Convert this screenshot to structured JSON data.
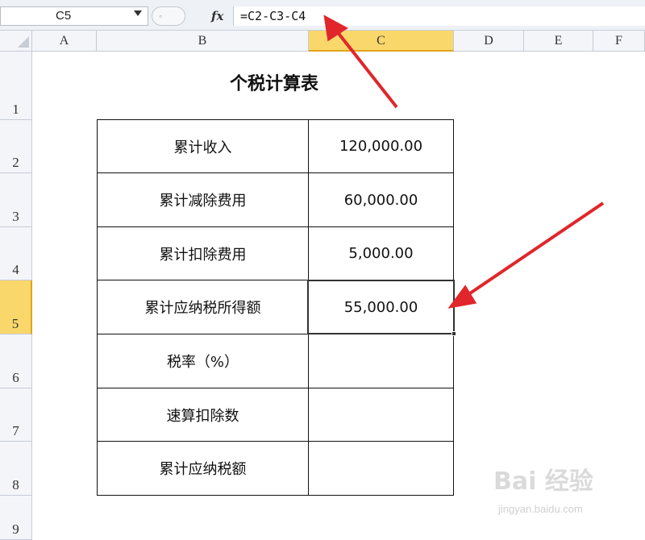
{
  "formula_bar": {
    "name_box": "C5",
    "fx_label": "fx",
    "formula": "=C2-C3-C4"
  },
  "columns": [
    {
      "label": "A",
      "active": false
    },
    {
      "label": "B",
      "active": false
    },
    {
      "label": "C",
      "active": true
    },
    {
      "label": "D",
      "active": false
    },
    {
      "label": "E",
      "active": false
    },
    {
      "label": "F",
      "active": false
    }
  ],
  "rows": [
    "1",
    "2",
    "3",
    "4",
    "5",
    "6",
    "7",
    "8",
    "9"
  ],
  "active_row": "5",
  "sheet": {
    "title": "个税计算表",
    "table": [
      {
        "label": "累计收入",
        "value": "120,000.00"
      },
      {
        "label": "累计减除费用",
        "value": "60,000.00"
      },
      {
        "label": "累计扣除费用",
        "value": "5,000.00"
      },
      {
        "label": "累计应纳税所得额",
        "value": "55,000.00"
      },
      {
        "label": "税率（%）",
        "value": ""
      },
      {
        "label": "速算扣除数",
        "value": ""
      },
      {
        "label": "累计应纳税额",
        "value": ""
      }
    ]
  },
  "watermark": {
    "main": "Bai 经验",
    "sub": "jingyan.baidu.com"
  },
  "colors": {
    "arrow": "#e0262b",
    "header_active": "#f9d76b"
  }
}
